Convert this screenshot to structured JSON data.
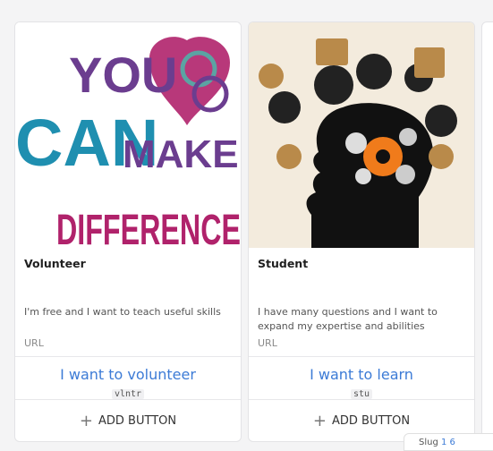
{
  "cards": [
    {
      "image_alt": "You can make a difference",
      "image_words": [
        "YOU",
        "CAN",
        "MAKE A",
        "DIFFERENCE"
      ],
      "title": "Volunteer",
      "description": "I'm free and I want to teach useful skills",
      "url_label": "URL",
      "action_label": "I want to volunteer",
      "action_code": "vlntr",
      "add_button": "ADD BUTTON"
    },
    {
      "image_alt": "Student head with gears and icons",
      "title": "Student",
      "description": "I have many questions and I want to expand my expertise and abilities",
      "url_label": "URL",
      "action_label": "I want to learn",
      "action_code": "stu",
      "add_button": "ADD BUTTON"
    }
  ],
  "bottom_stub": {
    "text": "Slug",
    "num": "1 6"
  },
  "colors": {
    "link": "#3c7bd6",
    "purple": "#6b3d8f",
    "teal": "#1f8fb0",
    "magenta": "#b0226b"
  }
}
